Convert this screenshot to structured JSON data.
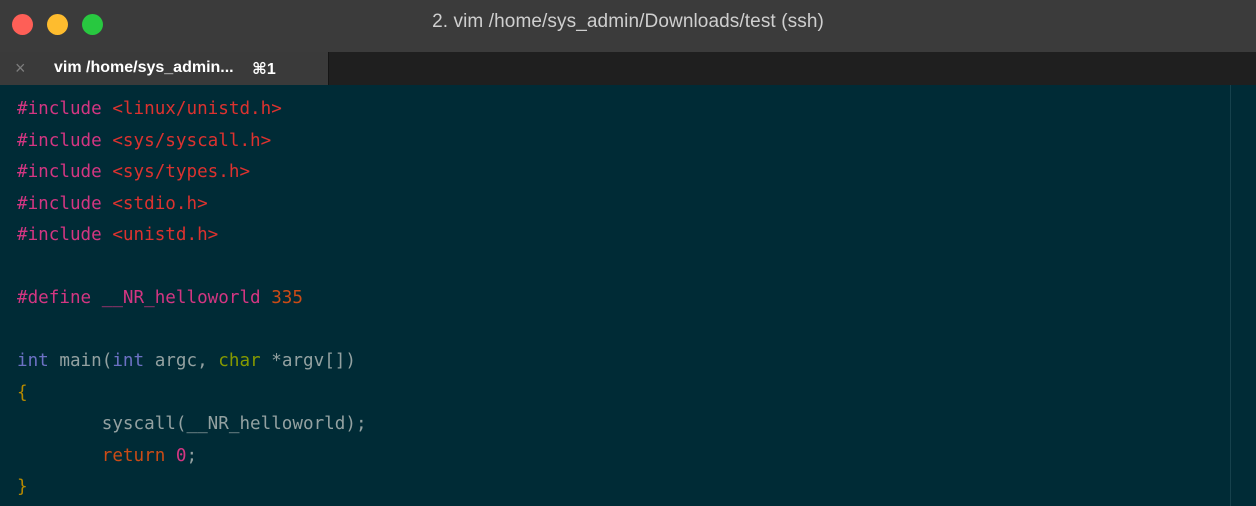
{
  "window": {
    "title": "2. vim /home/sys_admin/Downloads/test (ssh)",
    "controls": {
      "close_color": "#fe5f57",
      "minimize_color": "#febc2e",
      "zoom_color": "#28c840"
    }
  },
  "tabs": [
    {
      "label": "vim /home/sys_admin...",
      "shortcut": "⌘1",
      "close_glyph": "×"
    }
  ],
  "code": {
    "lines": [
      [
        {
          "t": "#include ",
          "c": "pp2"
        },
        {
          "t": "<linux/unistd.h>",
          "c": "hdr"
        }
      ],
      [
        {
          "t": "#include ",
          "c": "pp2"
        },
        {
          "t": "<sys/syscall.h>",
          "c": "hdr"
        }
      ],
      [
        {
          "t": "#include ",
          "c": "pp2"
        },
        {
          "t": "<sys/types.h>",
          "c": "hdr"
        }
      ],
      [
        {
          "t": "#include ",
          "c": "pp2"
        },
        {
          "t": "<stdio.h>",
          "c": "hdr"
        }
      ],
      [
        {
          "t": "#include ",
          "c": "pp2"
        },
        {
          "t": "<unistd.h>",
          "c": "hdr"
        }
      ],
      [],
      [
        {
          "t": "#define __NR_helloworld ",
          "c": "pp2"
        },
        {
          "t": "335",
          "c": "pp"
        }
      ],
      [],
      [
        {
          "t": "int",
          "c": "kw"
        },
        {
          "t": " main(",
          "c": "plain"
        },
        {
          "t": "int",
          "c": "kw"
        },
        {
          "t": " argc, ",
          "c": "plain"
        },
        {
          "t": "char",
          "c": "type"
        },
        {
          "t": " *argv[])",
          "c": "plain"
        }
      ],
      [
        {
          "t": "{",
          "c": "brace"
        }
      ],
      [
        {
          "t": "        syscall(__NR_helloworld);",
          "c": "plain"
        }
      ],
      [
        {
          "t": "        ",
          "c": "plain"
        },
        {
          "t": "return",
          "c": "ret"
        },
        {
          "t": " ",
          "c": "plain"
        },
        {
          "t": "0",
          "c": "num"
        },
        {
          "t": ";",
          "c": "plain"
        }
      ],
      [
        {
          "t": "}",
          "c": "brace"
        }
      ]
    ]
  }
}
